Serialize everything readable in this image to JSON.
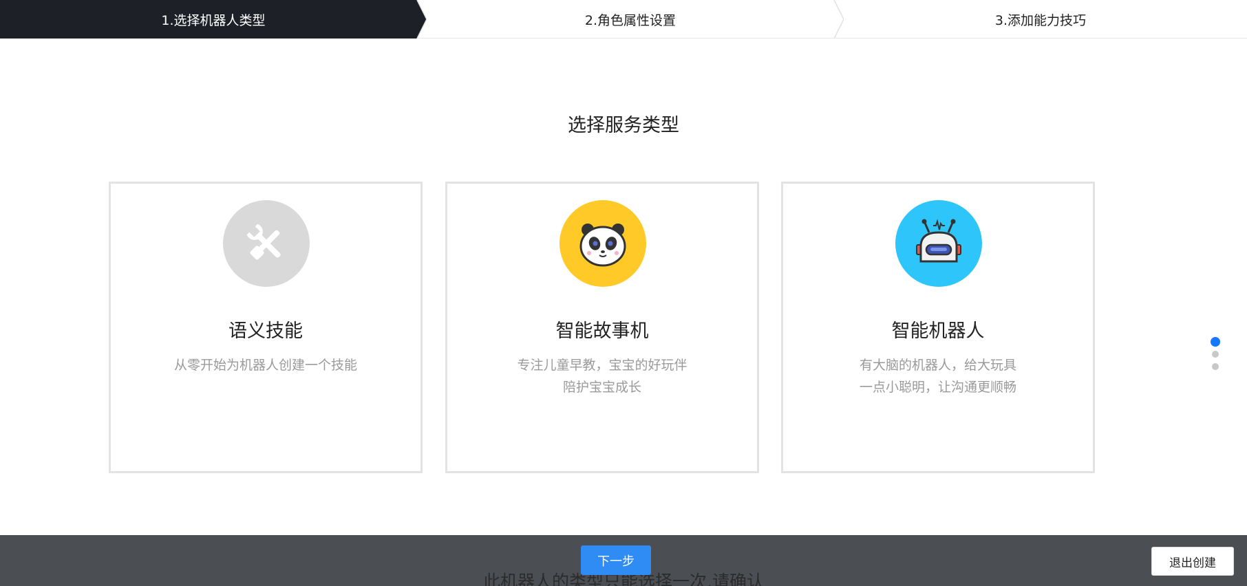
{
  "stepper": {
    "steps": [
      {
        "label": "1.选择机器人类型"
      },
      {
        "label": "2.角色属性设置"
      },
      {
        "label": "3.添加能力技巧"
      }
    ]
  },
  "main": {
    "title": "选择服务类型",
    "cards": [
      {
        "name": "语义技能",
        "desc_lines": [
          "从零开始为机器人创建一个技能"
        ],
        "icon": "tools-icon",
        "icon_bg": "#d9d9d9"
      },
      {
        "name": "智能故事机",
        "desc_lines": [
          "专注儿童早教，宝宝的好玩伴",
          "陪护宝宝成长"
        ],
        "icon": "panda-icon",
        "icon_bg": "#ffc928"
      },
      {
        "name": "智能机器人",
        "desc_lines": [
          "有大脑的机器人，给大玩具",
          "一点小聪明，让沟通更顺畅"
        ],
        "icon": "robot-icon",
        "icon_bg": "#2ec5fa"
      }
    ]
  },
  "pager": {
    "count": 3,
    "active_index": 0
  },
  "footer": {
    "next_label": "下一步",
    "exit_label": "退出创建",
    "warning": "此机器人的类型只能选择一次,请确认"
  },
  "colors": {
    "active_step_bg": "#1d2127",
    "primary": "#2f8cf5",
    "footer_bg": "#4b4e53",
    "dot_active": "#1677ff"
  }
}
